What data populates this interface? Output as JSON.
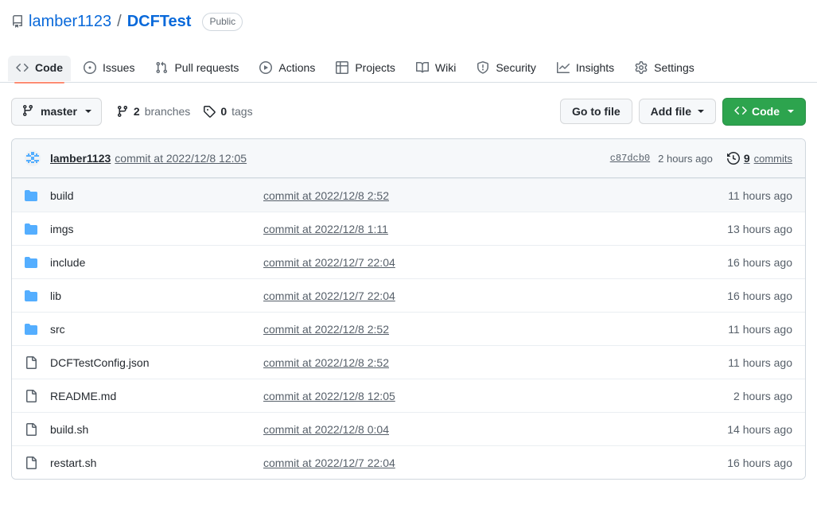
{
  "header": {
    "repo_icon": "repo-icon",
    "owner": "lamber1123",
    "separator": "/",
    "repo_name": "DCFTest",
    "visibility": "Public"
  },
  "nav": {
    "tabs": [
      {
        "label": "Code",
        "icon": "code-icon",
        "active": true
      },
      {
        "label": "Issues",
        "icon": "issue-opened-icon",
        "active": false
      },
      {
        "label": "Pull requests",
        "icon": "git-pull-request-icon",
        "active": false
      },
      {
        "label": "Actions",
        "icon": "play-icon",
        "active": false
      },
      {
        "label": "Projects",
        "icon": "table-icon",
        "active": false
      },
      {
        "label": "Wiki",
        "icon": "book-icon",
        "active": false
      },
      {
        "label": "Security",
        "icon": "shield-icon",
        "active": false
      },
      {
        "label": "Insights",
        "icon": "graph-icon",
        "active": false
      },
      {
        "label": "Settings",
        "icon": "gear-icon",
        "active": false
      }
    ]
  },
  "toolbar": {
    "branch": "master",
    "branches_count": "2",
    "branches_label": "branches",
    "tags_count": "0",
    "tags_label": "tags",
    "go_to_file": "Go to file",
    "add_file": "Add file",
    "code": "Code",
    "code_button_color": "#2da44e"
  },
  "commit_bar": {
    "author": "lamber1123",
    "message": "commit at 2022/12/8 12:05",
    "sha": "c87dcb0",
    "time": "2 hours ago",
    "commits_count": "9",
    "commits_label": "commits"
  },
  "files": [
    {
      "name": "build",
      "type": "folder",
      "commit": "commit at 2022/12/8 2:52",
      "age": "11 hours ago",
      "shaded": true
    },
    {
      "name": "imgs",
      "type": "folder",
      "commit": "commit at 2022/12/8 1:11",
      "age": "13 hours ago",
      "shaded": false
    },
    {
      "name": "include",
      "type": "folder",
      "commit": "commit at 2022/12/7 22:04",
      "age": "16 hours ago",
      "shaded": false
    },
    {
      "name": "lib",
      "type": "folder",
      "commit": "commit at 2022/12/7 22:04",
      "age": "16 hours ago",
      "shaded": false
    },
    {
      "name": "src",
      "type": "folder",
      "commit": "commit at 2022/12/8 2:52",
      "age": "11 hours ago",
      "shaded": false
    },
    {
      "name": "DCFTestConfig.json",
      "type": "file",
      "commit": "commit at 2022/12/8 2:52",
      "age": "11 hours ago",
      "shaded": false
    },
    {
      "name": "README.md",
      "type": "file",
      "commit": "commit at 2022/12/8 12:05",
      "age": "2 hours ago",
      "shaded": false
    },
    {
      "name": "build.sh",
      "type": "file",
      "commit": "commit at 2022/12/8 0:04",
      "age": "14 hours ago",
      "shaded": false
    },
    {
      "name": "restart.sh",
      "type": "file",
      "commit": "commit at 2022/12/7 22:04",
      "age": "16 hours ago",
      "shaded": false
    }
  ],
  "colors": {
    "link": "#0969da",
    "folder": "#54aeff",
    "accent_underline": "#fd8c73",
    "border": "#d0d7de",
    "muted_text": "#57606a"
  }
}
